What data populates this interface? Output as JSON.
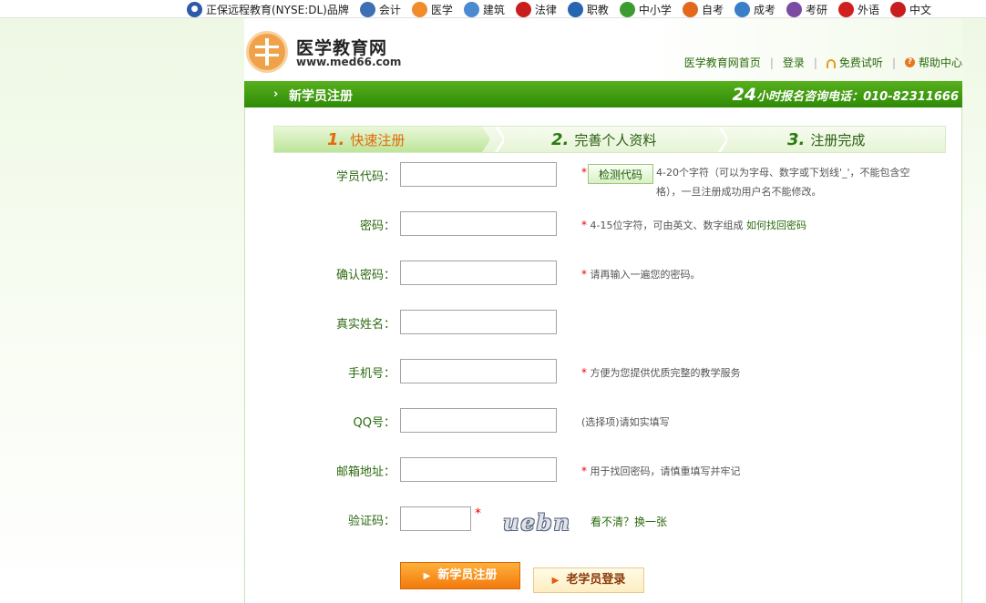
{
  "topnav": {
    "brand": "正保远程教育(NYSE:DL)品牌",
    "items": [
      {
        "label": "会计",
        "color": "#3c6fb4"
      },
      {
        "label": "医学",
        "color": "#f08c2a"
      },
      {
        "label": "建筑",
        "color": "#4a8ad1"
      },
      {
        "label": "法律",
        "color": "#c81e1e"
      },
      {
        "label": "职教",
        "color": "#2765b0"
      },
      {
        "label": "中小学",
        "color": "#3c9b2e"
      },
      {
        "label": "自考",
        "color": "#e3671c"
      },
      {
        "label": "成考",
        "color": "#3a7ec8"
      },
      {
        "label": "考研",
        "color": "#7a4ba0"
      },
      {
        "label": "外语",
        "color": "#d01f1f"
      },
      {
        "label": "中文",
        "color": "#c81e1e"
      }
    ]
  },
  "header": {
    "site_name": "医学教育网",
    "site_url": "www.med66.com",
    "links": {
      "home": "医学教育网首页",
      "login": "登录",
      "trial": "免费试听",
      "help": "帮助中心"
    }
  },
  "titlebar": {
    "title": "新学员注册",
    "hotline_num": "24",
    "hotline": "小时报名咨询电话：010-82311666"
  },
  "steps": [
    {
      "num": "1.",
      "label": "快速注册"
    },
    {
      "num": "2.",
      "label": "完善个人资料"
    },
    {
      "num": "3.",
      "label": "注册完成"
    }
  ],
  "form": {
    "required_mark": "*",
    "fields": {
      "code": {
        "label": "学员代码：",
        "check_button": "检测代码",
        "hint": "4-20个字符（可以为字母、数字或下划线'_'，不能包含空格），一旦注册成功用户名不能修改。"
      },
      "password": {
        "label": "密码：",
        "hint": "4-15位字符，可由英文、数字组成",
        "link": "如何找回密码"
      },
      "confirm": {
        "label": "确认密码：",
        "hint": "请再输入一遍您的密码。"
      },
      "realname": {
        "label": "真实姓名："
      },
      "mobile": {
        "label": "手机号：",
        "hint": "方便为您提供优质完整的教学服务"
      },
      "qq": {
        "label": "QQ号：",
        "hint": "(选择项)请如实填写"
      },
      "email": {
        "label": "邮箱地址：",
        "hint": "用于找回密码，请慎重填写并牢记"
      },
      "captcha": {
        "label": "验证码：",
        "captcha_text": "uebn",
        "refresh": "看不清？换一张"
      }
    },
    "buttons": {
      "register": "新学员注册",
      "old_login": "老学员登录"
    }
  }
}
